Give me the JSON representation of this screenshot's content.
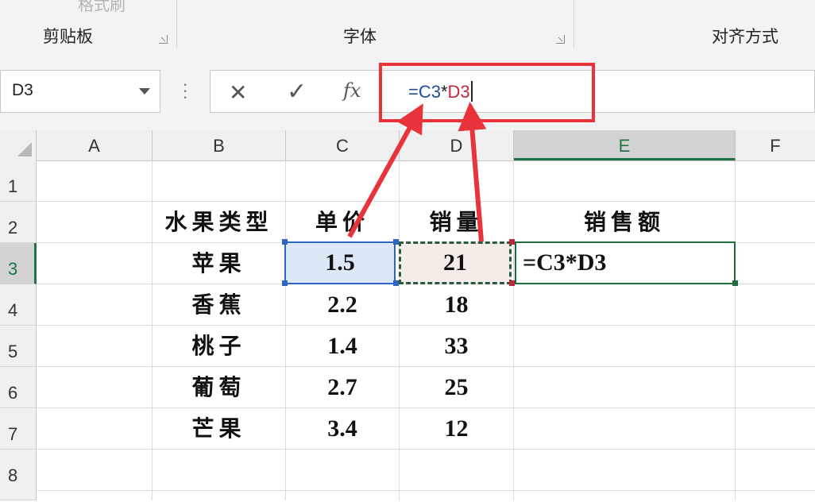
{
  "ribbon": {
    "top_label": "格式刷",
    "groups": [
      {
        "label": "剪贴板"
      },
      {
        "label": "字体"
      },
      {
        "label": "对齐方式"
      }
    ]
  },
  "formula_bar": {
    "name_box": "D3",
    "cancel_icon": "✕",
    "enter_icon": "✓",
    "fx_icon": "fx",
    "formula": {
      "eq": "=",
      "c3": "C3",
      "op": "*",
      "d3": "D3"
    }
  },
  "columns": [
    "A",
    "B",
    "C",
    "D",
    "E",
    "F"
  ],
  "active_column": "E",
  "rows": [
    "1",
    "2",
    "3",
    "4",
    "5",
    "6",
    "7",
    "8"
  ],
  "active_row": "3",
  "table": {
    "headers": [
      "水果类型",
      "单价",
      "销量",
      "销售额"
    ],
    "rows": [
      {
        "fruit": "苹果",
        "price": "1.5",
        "qty": "21",
        "total": "=C3*D3"
      },
      {
        "fruit": "香蕉",
        "price": "2.2",
        "qty": "18",
        "total": ""
      },
      {
        "fruit": "桃子",
        "price": "1.4",
        "qty": "33",
        "total": ""
      },
      {
        "fruit": "葡萄",
        "price": "2.7",
        "qty": "25",
        "total": ""
      },
      {
        "fruit": "芒果",
        "price": "3.4",
        "qty": "12",
        "total": ""
      }
    ]
  },
  "colors": {
    "annotation_red": "#e8333b",
    "ref_blue": "#2f66c4",
    "ref_red": "#c0283a",
    "active_green": "#217346"
  }
}
